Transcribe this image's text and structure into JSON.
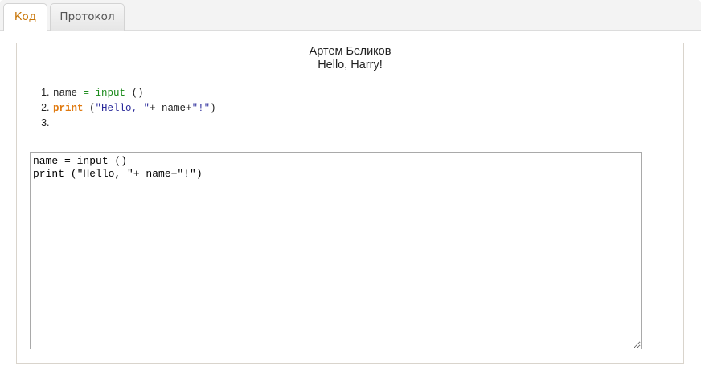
{
  "tabs": [
    {
      "label": "Код",
      "active": true
    },
    {
      "label": "Протокол",
      "active": false
    }
  ],
  "panel": {
    "author": "Артем Беликов",
    "output": "Hello, Harry!"
  },
  "code_lines": [
    {
      "number": "1.",
      "text": "name = input ()"
    },
    {
      "number": "2.",
      "text": "print (\"Hello, \"+ name+\"!\")"
    },
    {
      "number": "3.",
      "text": ""
    }
  ],
  "editor": {
    "value": "name = input ()\nprint (\"Hello, \"+ name+\"!\")"
  },
  "colors": {
    "active_tab_text": "#c77405",
    "keyword_print": "#e07a10",
    "keyword_green": "#1a8a1a",
    "string": "#2a2a9a"
  }
}
